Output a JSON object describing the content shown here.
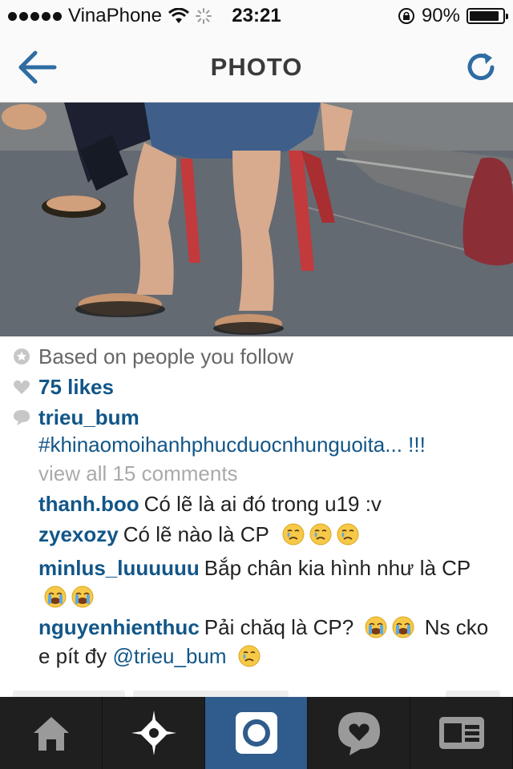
{
  "status_bar": {
    "carrier": "VinaPhone",
    "time": "23:21",
    "battery": "90%",
    "battery_level": 0.9
  },
  "nav": {
    "title": "PHOTO",
    "back_icon": "back-arrow-icon",
    "refresh_icon": "refresh-icon"
  },
  "post": {
    "suggestion": "Based on people you follow",
    "likes": "75 likes",
    "author": "trieu_bum",
    "caption": "#khinaomoihanhphucduocnhunguoita... !!!",
    "view_all": "view all 15 comments"
  },
  "comments": [
    {
      "user": "thanh.boo",
      "text": "Có lẽ là ai đó trong u19 :v",
      "emoji_count": 0
    },
    {
      "user": "zyexozy",
      "text": "Có lẽ nào là CP",
      "emoji_count": 3
    },
    {
      "user": "minlus_luuuuuu",
      "text": "Bắp chân kia hình như là CP",
      "emoji_count": 2
    },
    {
      "user": "nguyenhienthuc",
      "text_a": "Pải chăq là CP?",
      "text_b": "Ns cko e pít đy",
      "mention": "@trieu_bum"
    }
  ],
  "tabs": [
    {
      "name": "home",
      "icon": "home-icon"
    },
    {
      "name": "explore",
      "icon": "explore-star-icon"
    },
    {
      "name": "camera",
      "icon": "camera-icon",
      "active": true
    },
    {
      "name": "activity",
      "icon": "heart-bubble-icon"
    },
    {
      "name": "profile",
      "icon": "profile-card-icon"
    }
  ],
  "colors": {
    "accent_blue": "#125688",
    "active_tab": "#2f5c8c",
    "tab_bar": "#1f1f1f"
  }
}
